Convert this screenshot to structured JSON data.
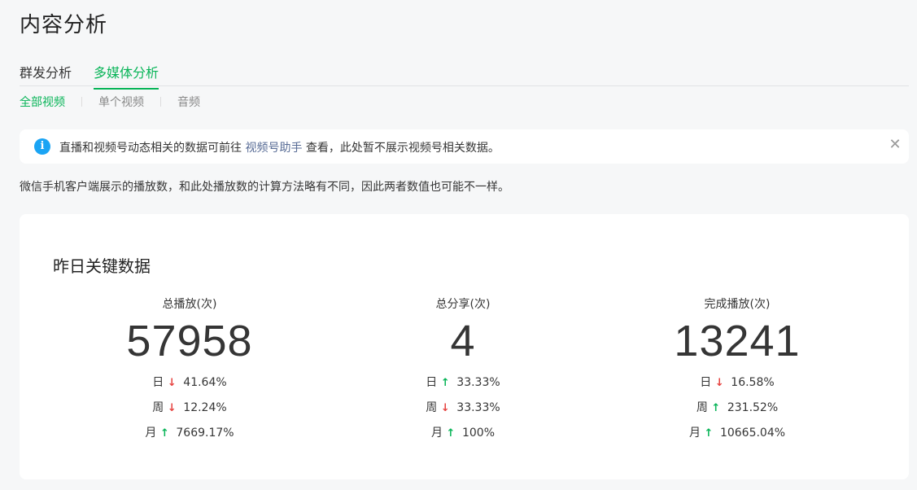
{
  "page": {
    "title": "内容分析"
  },
  "main_tabs": [
    {
      "label": "群发分析",
      "active": false
    },
    {
      "label": "多媒体分析",
      "active": true
    }
  ],
  "sub_tabs": [
    {
      "label": "全部视频",
      "active": true
    },
    {
      "label": "单个视频",
      "active": false
    },
    {
      "label": "音频",
      "active": false
    }
  ],
  "notice": {
    "icon": "info-icon",
    "text_before": "直播和视频号动态相关的数据可前往 ",
    "link": "视频号助手",
    "text_after": " 查看，此处暂不展示视频号相关数据。",
    "close_icon": "close-icon"
  },
  "description": "微信手机客户端展示的播放数，和此处播放数的计算方法略有不同，因此两者数值也可能不一样。",
  "card": {
    "title": "昨日关键数据",
    "metrics": [
      {
        "label": "总播放(次)",
        "value": "57958",
        "trends": [
          {
            "label": "日",
            "direction": "down",
            "value": "41.64%"
          },
          {
            "label": "周",
            "direction": "down",
            "value": "12.24%"
          },
          {
            "label": "月",
            "direction": "up",
            "value": "7669.17%"
          }
        ]
      },
      {
        "label": "总分享(次)",
        "value": "4",
        "trends": [
          {
            "label": "日",
            "direction": "up",
            "value": "33.33%"
          },
          {
            "label": "周",
            "direction": "down",
            "value": "33.33%"
          },
          {
            "label": "月",
            "direction": "up",
            "value": "100%"
          }
        ]
      },
      {
        "label": "完成播放(次)",
        "value": "13241",
        "trends": [
          {
            "label": "日",
            "direction": "down",
            "value": "16.58%"
          },
          {
            "label": "周",
            "direction": "up",
            "value": "231.52%"
          },
          {
            "label": "月",
            "direction": "up",
            "value": "10665.04%"
          }
        ]
      }
    ]
  },
  "colors": {
    "accent_green": "#07b457",
    "down_red": "#e64340",
    "link_blue": "#576b95",
    "info_blue": "#1aa4f4"
  }
}
